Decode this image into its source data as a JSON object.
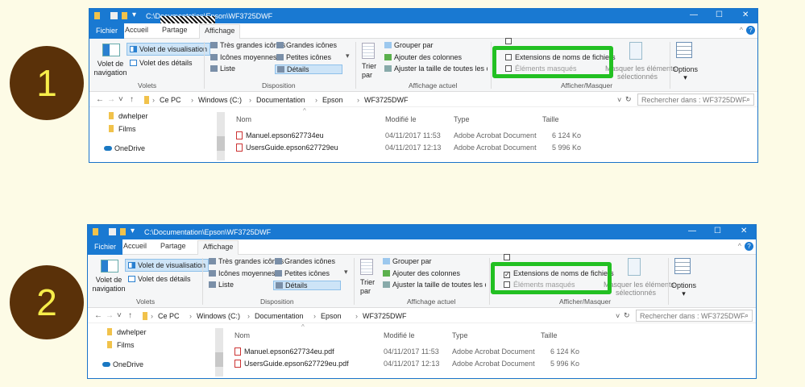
{
  "steps": [
    {
      "number": "1",
      "window": {
        "title": "C:\\Documentation\\Epson\\WF3725DWF",
        "tabs": [
          "Fichier",
          "Accueil",
          "Partage",
          "Affichage"
        ],
        "active_tab": "Affichage",
        "ribbon": {
          "nav_pane_label_1": "Volet de",
          "nav_pane_label_2": "navigation",
          "preview_pane": "Volet de visualisation",
          "details_pane": "Volet des détails",
          "group_panes": "Volets",
          "layouts": [
            "Très grandes icônes",
            "Grandes icônes",
            "Icônes moyennes",
            "Petites icônes",
            "Liste",
            "Détails"
          ],
          "selected_layout": "Détails",
          "group_layout": "Disposition",
          "sort_1": "Trier",
          "sort_2": "par",
          "group_by": "Grouper par",
          "add_columns": "Ajouter des colonnes",
          "fit_columns": "Ajuster la taille de toutes les colonnes",
          "group_current_view": "Affichage actuel",
          "file_extensions": "Extensions de noms de fichiers",
          "file_extensions_checked": false,
          "hidden_items": "Éléments masqués",
          "hide_selected_1": "Masquer les éléments",
          "hide_selected_2": "sélectionnés",
          "group_show_hide": "Afficher/Masquer",
          "options": "Options"
        },
        "breadcrumb": [
          "Ce PC",
          "Windows (C:)",
          "Documentation",
          "Epson",
          "WF3725DWF"
        ],
        "search_placeholder": "Rechercher dans : WF3725DWF",
        "nav_items": [
          "dwhelper",
          "Films",
          "OneDrive"
        ],
        "columns": [
          "Nom",
          "Modifié le",
          "Type",
          "Taille"
        ],
        "files": [
          {
            "name": "Manuel.epson627734eu",
            "modified": "04/11/2017 11:53",
            "type": "Adobe Acrobat Document",
            "size": "6 124 Ko"
          },
          {
            "name": "UsersGuide.epson627729eu",
            "modified": "04/11/2017 12:13",
            "type": "Adobe Acrobat Document",
            "size": "5 996 Ko"
          }
        ]
      }
    },
    {
      "number": "2",
      "window": {
        "title": "C:\\Documentation\\Epson\\WF3725DWF",
        "tabs": [
          "Fichier",
          "Accueil",
          "Partage",
          "Affichage"
        ],
        "active_tab": "Affichage",
        "ribbon": {
          "nav_pane_label_1": "Volet de",
          "nav_pane_label_2": "navigation",
          "preview_pane": "Volet de visualisation",
          "details_pane": "Volet des détails",
          "group_panes": "Volets",
          "layouts": [
            "Très grandes icônes",
            "Grandes icônes",
            "Icônes moyennes",
            "Petites icônes",
            "Liste",
            "Détails"
          ],
          "selected_layout": "Détails",
          "group_layout": "Disposition",
          "sort_1": "Trier",
          "sort_2": "par",
          "group_by": "Grouper par",
          "add_columns": "Ajouter des colonnes",
          "fit_columns": "Ajuster la taille de toutes les colonnes",
          "group_current_view": "Affichage actuel",
          "file_extensions": "Extensions de noms de fichiers",
          "file_extensions_checked": true,
          "hidden_items": "Éléments masqués",
          "hide_selected_1": "Masquer les éléments",
          "hide_selected_2": "sélectionnés",
          "group_show_hide": "Afficher/Masquer",
          "options": "Options"
        },
        "breadcrumb": [
          "Ce PC",
          "Windows (C:)",
          "Documentation",
          "Epson",
          "WF3725DWF"
        ],
        "search_placeholder": "Rechercher dans : WF3725DWF",
        "nav_items": [
          "dwhelper",
          "Films",
          "OneDrive"
        ],
        "columns": [
          "Nom",
          "Modifié le",
          "Type",
          "Taille"
        ],
        "files": [
          {
            "name": "Manuel.epson627734eu.pdf",
            "modified": "04/11/2017 11:53",
            "type": "Adobe Acrobat Document",
            "size": "6 124 Ko"
          },
          {
            "name": "UsersGuide.epson627729eu.pdf",
            "modified": "04/11/2017 12:13",
            "type": "Adobe Acrobat Document",
            "size": "5 996 Ko"
          }
        ]
      }
    }
  ],
  "colors": {
    "accent": "#1979d2",
    "highlight": "#22c022",
    "circle": "#5a3109",
    "circle_text": "#f7ee4a"
  }
}
